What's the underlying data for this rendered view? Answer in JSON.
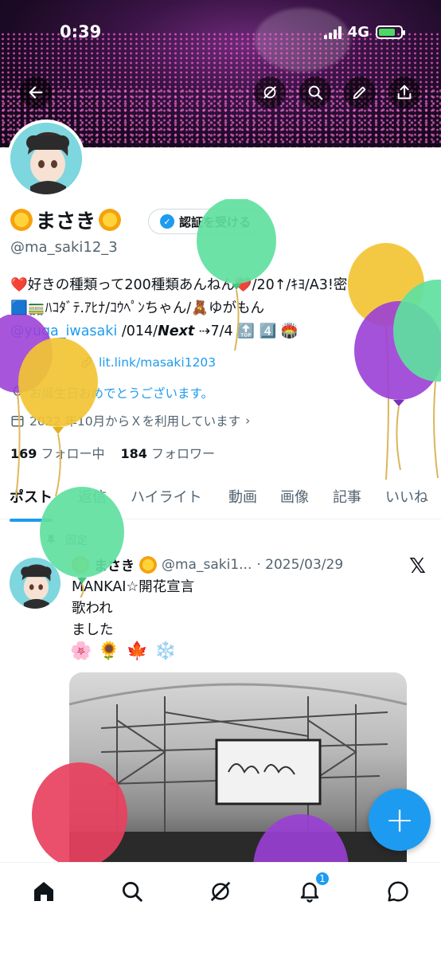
{
  "status_bar": {
    "time": "0:39",
    "network": "4G"
  },
  "profile": {
    "display_name": "まさき",
    "verify_button": "認証を受ける",
    "handle": "@ma_saki12_3",
    "bio_line1": "❤️好きの種類って200種類あんねん❤️/20↑/ｷﾖ/A3!密",
    "bio_line2": "🟦🚃ﾊｺﾀﾞﾃ.ｱﾋﾅ/ｺｳﾍﾟﾝちゃん/🧸ゆがもん",
    "bio_mention": "@yuga_iwasaki",
    "bio_tail_a": "/014/",
    "bio_tail_next": "Next",
    "bio_tail_b": " ⇢7/4 🔝 4️⃣ 🏟️",
    "link": "lit.link/masaki1203",
    "birthday": "お誕生日おめでとうございます。",
    "joined": "2022 年10月からＸを利用しています",
    "following_count": "169",
    "following_label": "フォロー中",
    "followers_count": "184",
    "followers_label": "フォロワー"
  },
  "tabs": [
    "ポスト",
    "返信",
    "ハイライト",
    "動画",
    "画像",
    "記事",
    "いいね"
  ],
  "active_tab": "ポスト",
  "pinned_label": "固定",
  "post": {
    "name": "まさき",
    "handle": "@ma_saki1...",
    "date": "· 2025/03/29",
    "text": "MANKAI☆開花宣言\n歌われ\nました",
    "emojis": [
      "🌸",
      "🌻",
      "🍁",
      "❄️"
    ],
    "x_logo": "𝕏"
  },
  "notification_badge": "1",
  "fab_label": "+",
  "colors": {
    "accent": "#1d9bf0",
    "text": "#0f1419",
    "muted": "#536471"
  }
}
